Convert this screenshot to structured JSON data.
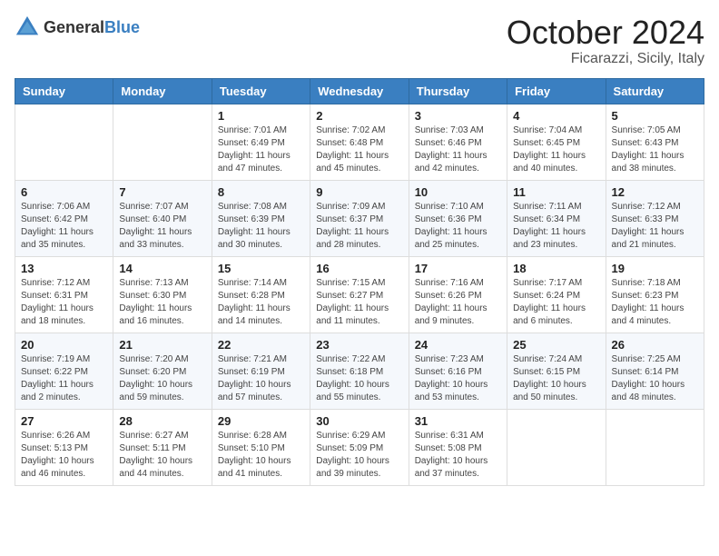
{
  "header": {
    "logo": {
      "general": "General",
      "blue": "Blue"
    },
    "title": "October 2024",
    "location": "Ficarazzi, Sicily, Italy"
  },
  "days_of_week": [
    "Sunday",
    "Monday",
    "Tuesday",
    "Wednesday",
    "Thursday",
    "Friday",
    "Saturday"
  ],
  "weeks": [
    [
      {
        "day": "",
        "sunrise": "",
        "sunset": "",
        "daylight": ""
      },
      {
        "day": "",
        "sunrise": "",
        "sunset": "",
        "daylight": ""
      },
      {
        "day": "1",
        "sunrise": "Sunrise: 7:01 AM",
        "sunset": "Sunset: 6:49 PM",
        "daylight": "Daylight: 11 hours and 47 minutes."
      },
      {
        "day": "2",
        "sunrise": "Sunrise: 7:02 AM",
        "sunset": "Sunset: 6:48 PM",
        "daylight": "Daylight: 11 hours and 45 minutes."
      },
      {
        "day": "3",
        "sunrise": "Sunrise: 7:03 AM",
        "sunset": "Sunset: 6:46 PM",
        "daylight": "Daylight: 11 hours and 42 minutes."
      },
      {
        "day": "4",
        "sunrise": "Sunrise: 7:04 AM",
        "sunset": "Sunset: 6:45 PM",
        "daylight": "Daylight: 11 hours and 40 minutes."
      },
      {
        "day": "5",
        "sunrise": "Sunrise: 7:05 AM",
        "sunset": "Sunset: 6:43 PM",
        "daylight": "Daylight: 11 hours and 38 minutes."
      }
    ],
    [
      {
        "day": "6",
        "sunrise": "Sunrise: 7:06 AM",
        "sunset": "Sunset: 6:42 PM",
        "daylight": "Daylight: 11 hours and 35 minutes."
      },
      {
        "day": "7",
        "sunrise": "Sunrise: 7:07 AM",
        "sunset": "Sunset: 6:40 PM",
        "daylight": "Daylight: 11 hours and 33 minutes."
      },
      {
        "day": "8",
        "sunrise": "Sunrise: 7:08 AM",
        "sunset": "Sunset: 6:39 PM",
        "daylight": "Daylight: 11 hours and 30 minutes."
      },
      {
        "day": "9",
        "sunrise": "Sunrise: 7:09 AM",
        "sunset": "Sunset: 6:37 PM",
        "daylight": "Daylight: 11 hours and 28 minutes."
      },
      {
        "day": "10",
        "sunrise": "Sunrise: 7:10 AM",
        "sunset": "Sunset: 6:36 PM",
        "daylight": "Daylight: 11 hours and 25 minutes."
      },
      {
        "day": "11",
        "sunrise": "Sunrise: 7:11 AM",
        "sunset": "Sunset: 6:34 PM",
        "daylight": "Daylight: 11 hours and 23 minutes."
      },
      {
        "day": "12",
        "sunrise": "Sunrise: 7:12 AM",
        "sunset": "Sunset: 6:33 PM",
        "daylight": "Daylight: 11 hours and 21 minutes."
      }
    ],
    [
      {
        "day": "13",
        "sunrise": "Sunrise: 7:12 AM",
        "sunset": "Sunset: 6:31 PM",
        "daylight": "Daylight: 11 hours and 18 minutes."
      },
      {
        "day": "14",
        "sunrise": "Sunrise: 7:13 AM",
        "sunset": "Sunset: 6:30 PM",
        "daylight": "Daylight: 11 hours and 16 minutes."
      },
      {
        "day": "15",
        "sunrise": "Sunrise: 7:14 AM",
        "sunset": "Sunset: 6:28 PM",
        "daylight": "Daylight: 11 hours and 14 minutes."
      },
      {
        "day": "16",
        "sunrise": "Sunrise: 7:15 AM",
        "sunset": "Sunset: 6:27 PM",
        "daylight": "Daylight: 11 hours and 11 minutes."
      },
      {
        "day": "17",
        "sunrise": "Sunrise: 7:16 AM",
        "sunset": "Sunset: 6:26 PM",
        "daylight": "Daylight: 11 hours and 9 minutes."
      },
      {
        "day": "18",
        "sunrise": "Sunrise: 7:17 AM",
        "sunset": "Sunset: 6:24 PM",
        "daylight": "Daylight: 11 hours and 6 minutes."
      },
      {
        "day": "19",
        "sunrise": "Sunrise: 7:18 AM",
        "sunset": "Sunset: 6:23 PM",
        "daylight": "Daylight: 11 hours and 4 minutes."
      }
    ],
    [
      {
        "day": "20",
        "sunrise": "Sunrise: 7:19 AM",
        "sunset": "Sunset: 6:22 PM",
        "daylight": "Daylight: 11 hours and 2 minutes."
      },
      {
        "day": "21",
        "sunrise": "Sunrise: 7:20 AM",
        "sunset": "Sunset: 6:20 PM",
        "daylight": "Daylight: 10 hours and 59 minutes."
      },
      {
        "day": "22",
        "sunrise": "Sunrise: 7:21 AM",
        "sunset": "Sunset: 6:19 PM",
        "daylight": "Daylight: 10 hours and 57 minutes."
      },
      {
        "day": "23",
        "sunrise": "Sunrise: 7:22 AM",
        "sunset": "Sunset: 6:18 PM",
        "daylight": "Daylight: 10 hours and 55 minutes."
      },
      {
        "day": "24",
        "sunrise": "Sunrise: 7:23 AM",
        "sunset": "Sunset: 6:16 PM",
        "daylight": "Daylight: 10 hours and 53 minutes."
      },
      {
        "day": "25",
        "sunrise": "Sunrise: 7:24 AM",
        "sunset": "Sunset: 6:15 PM",
        "daylight": "Daylight: 10 hours and 50 minutes."
      },
      {
        "day": "26",
        "sunrise": "Sunrise: 7:25 AM",
        "sunset": "Sunset: 6:14 PM",
        "daylight": "Daylight: 10 hours and 48 minutes."
      }
    ],
    [
      {
        "day": "27",
        "sunrise": "Sunrise: 6:26 AM",
        "sunset": "Sunset: 5:13 PM",
        "daylight": "Daylight: 10 hours and 46 minutes."
      },
      {
        "day": "28",
        "sunrise": "Sunrise: 6:27 AM",
        "sunset": "Sunset: 5:11 PM",
        "daylight": "Daylight: 10 hours and 44 minutes."
      },
      {
        "day": "29",
        "sunrise": "Sunrise: 6:28 AM",
        "sunset": "Sunset: 5:10 PM",
        "daylight": "Daylight: 10 hours and 41 minutes."
      },
      {
        "day": "30",
        "sunrise": "Sunrise: 6:29 AM",
        "sunset": "Sunset: 5:09 PM",
        "daylight": "Daylight: 10 hours and 39 minutes."
      },
      {
        "day": "31",
        "sunrise": "Sunrise: 6:31 AM",
        "sunset": "Sunset: 5:08 PM",
        "daylight": "Daylight: 10 hours and 37 minutes."
      },
      {
        "day": "",
        "sunrise": "",
        "sunset": "",
        "daylight": ""
      },
      {
        "day": "",
        "sunrise": "",
        "sunset": "",
        "daylight": ""
      }
    ]
  ]
}
